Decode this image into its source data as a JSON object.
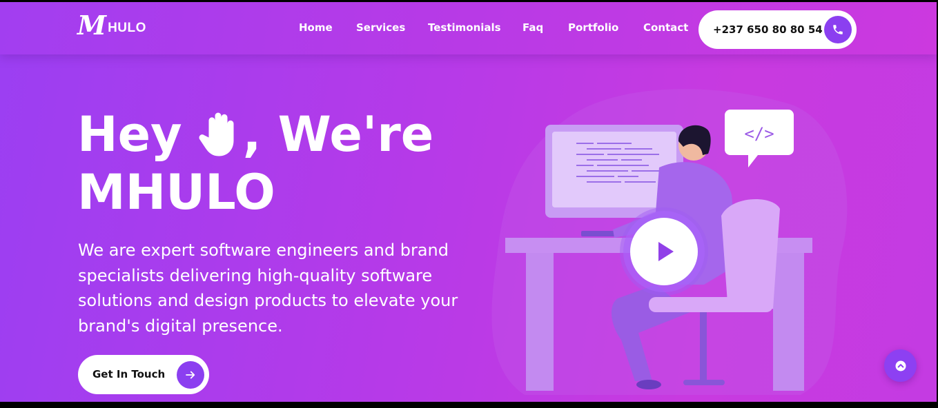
{
  "brand": {
    "logo_mark": "M",
    "logo_text": "HULO"
  },
  "nav": {
    "items": [
      "Home",
      "Services",
      "Testimonials",
      "Faq",
      "Portfolio",
      "Contact"
    ]
  },
  "contact": {
    "phone": "+237 650 80 80 54",
    "phone_icon": "phone-icon"
  },
  "hero": {
    "title_part1": "Hey",
    "title_part2": ", We're",
    "title_line2": "MHULO",
    "wave_icon": "raised-hand-icon",
    "description": "We are expert software engineers and brand specialists delivering high-quality software solutions and design products to elevate your brand's digital presence.",
    "cta_label": "Get In Touch",
    "cta_icon": "arrow-right-icon"
  },
  "illustration": {
    "code_bubble": "</>",
    "play_icon": "play-icon"
  },
  "scroll_top_icon": "chevron-up-icon",
  "colors": {
    "accent": "#8b3ff0",
    "gradient_start": "#9b3ff2",
    "gradient_end": "#c83ae0"
  }
}
